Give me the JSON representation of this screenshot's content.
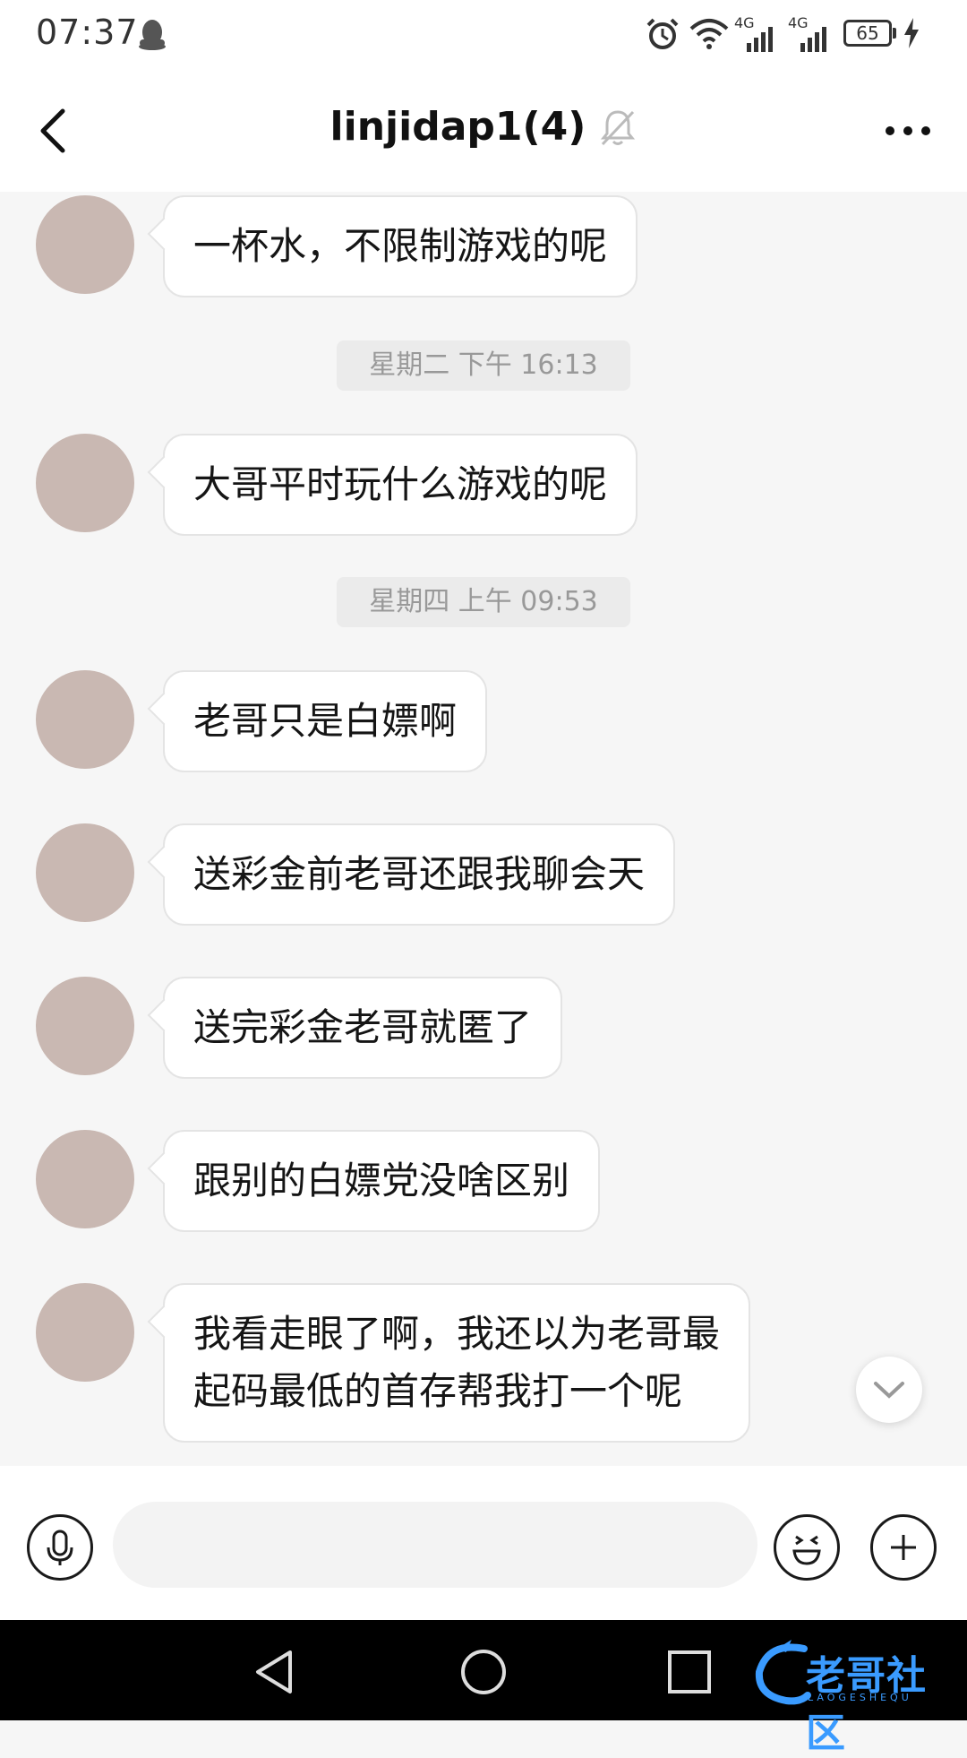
{
  "status_bar": {
    "time": "07:37",
    "battery": "65",
    "network_1": "4G",
    "network_2": "4G",
    "icons": [
      "qq-penguin-icon",
      "alarm-icon",
      "wifi-icon",
      "signal-icon",
      "signal-icon",
      "battery-icon",
      "charging-icon"
    ]
  },
  "header": {
    "title": "linjidap1(4)",
    "icons": [
      "back-icon",
      "mute-bell-icon",
      "more-icon"
    ]
  },
  "chat": {
    "messages": [
      {
        "type": "message",
        "text": "一杯水，不限制游戏的呢"
      },
      {
        "type": "time",
        "text": "星期二 下午 16:13"
      },
      {
        "type": "message",
        "text": "大哥平时玩什么游戏的呢"
      },
      {
        "type": "time",
        "text": "星期四 上午 09:53"
      },
      {
        "type": "message",
        "text": "老哥只是白嫖啊"
      },
      {
        "type": "message",
        "text": "送彩金前老哥还跟我聊会天"
      },
      {
        "type": "message",
        "text": "送完彩金老哥就匿了"
      },
      {
        "type": "message",
        "text": "跟别的白嫖党没啥区别"
      },
      {
        "type": "message",
        "text": "我看走眼了啊，我还以为老哥最\n起码最低的首存帮我打一个呢"
      }
    ]
  },
  "input_bar": {
    "placeholder": "",
    "icons": [
      "microphone-icon",
      "emoji-icon",
      "plus-icon"
    ]
  },
  "nav_bar": {
    "icons": [
      "nav-back-icon",
      "nav-home-icon",
      "nav-recent-icon"
    ]
  },
  "watermark": {
    "text": "老哥社区",
    "sub": "LAOGESHEQU"
  },
  "colors": {
    "background": "#f6f6f6",
    "bubble": "#ffffff",
    "time_pill": "#ebebeb",
    "watermark": "#3a9bff"
  }
}
